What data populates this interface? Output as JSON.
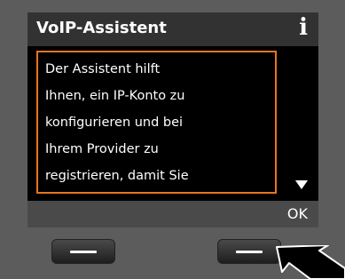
{
  "screen": {
    "title": "VoIP-Assistent",
    "info_icon": "i",
    "content_lines": [
      "Der Assistent hilft",
      "Ihnen, ein IP-Konto zu",
      "konfigurieren und bei",
      "Ihrem Provider zu",
      "registrieren, damit Sie"
    ],
    "softkey_right": "OK"
  },
  "colors": {
    "frame_accent": "#e8741e",
    "screen_bg": "#000000",
    "title_bar_bg": "#323232",
    "bezel": "#5c5c5c"
  },
  "icons": [
    "info-icon",
    "scroll-down-arrow-icon",
    "pointer-arrow-icon"
  ]
}
